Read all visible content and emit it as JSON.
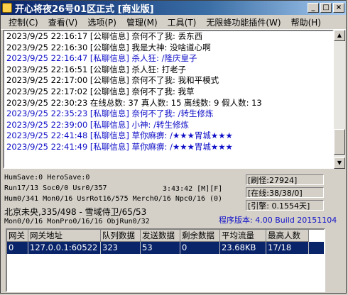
{
  "window": {
    "title": "开心将夜26号01区正式 [商业版]",
    "buttons": [
      "_",
      "□",
      "×"
    ]
  },
  "menu": [
    "控制(C)",
    "查看(V)",
    "选项(P)",
    "管理(M)",
    "工具(T)",
    "无限蜂功能插件(W)",
    "帮助(H)"
  ],
  "log": [
    {
      "text": "2023/9/25 22:16:17 [公聊信息] 奈何不了我: 丢东西",
      "color": "black"
    },
    {
      "text": "2023/9/25 22:16:30 [公聊信息] 我是大神: 没啥道心啊",
      "color": "black"
    },
    {
      "text": "2023/9/25 22:16:47 [私聊信息] 杀人狂: /隆庆皇子",
      "color": "blue"
    },
    {
      "text": "2023/9/25 22:16:51 [公聊信息] 杀人狂: 打老子",
      "color": "black"
    },
    {
      "text": "2023/9/25 22:17:00 [公聊信息] 奈何不了我: 我和平模式",
      "color": "black"
    },
    {
      "text": "2023/9/25 22:17:02 [公聊信息] 奈何不了我: 我草",
      "color": "black"
    },
    {
      "text": "2023/9/25 22:30:23 在线总数: 37 真人数: 15 离线数: 9 假人数: 13",
      "color": "black"
    },
    {
      "text": "2023/9/25 22:35:23 [私聊信息] 奈何不了我: /转生修炼",
      "color": "blue"
    },
    {
      "text": "2023/9/25 22:39:00 [私聊信息] 小神: /转生修炼",
      "color": "blue"
    },
    {
      "text": "2023/9/25 22:41:48 [私聊信息] 草你麻痹: /★★★胃城★★★",
      "color": "blue"
    },
    {
      "text": "2023/9/25 22:41:49 [私聊信息] 草你麻痹: /★★★胃城★★★",
      "color": "blue"
    }
  ],
  "status": {
    "line1": "HumSave:0 HeroSave:0",
    "line2": "Run17/13 Soc0/0 Usr0/357",
    "time": "3:43:42 [M][F]",
    "line3": "Hum0/341 Mon0/16 UsrRot16/575 Merch0/16 Npc0/16 (0)",
    "region": "北京未央,335/498 - 雪域侍卫/65/53",
    "line4": "Mon0/0/16 MonPro0/16/16 ObjRun0/32",
    "refresh": "[刷怪:27924]",
    "online": "[在线:38/38/0]",
    "engine": "[引擎: 0.1554天]",
    "version": "程序版本: 4.00 Build 20151104"
  },
  "gateway_table": {
    "columns": [
      "网关",
      "网关地址",
      "队列数据",
      "发送数据",
      "剩余数据",
      "平均流量",
      "最高人数"
    ],
    "rows": [
      [
        "0",
        "127.0.0.1:60522",
        "323",
        "53",
        "0",
        "23.68KB",
        "17/18"
      ]
    ]
  }
}
